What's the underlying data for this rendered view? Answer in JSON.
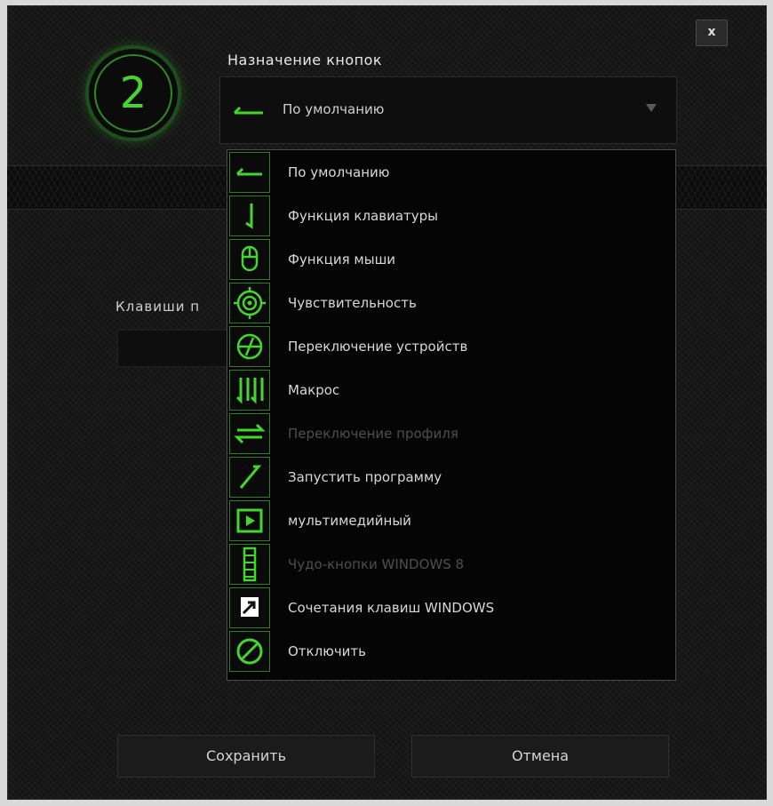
{
  "dialog": {
    "close_label": "x",
    "button_number": "2",
    "title": "Назначение кнопок",
    "selected": {
      "label": "По умолчанию",
      "icon": "default-arrow-icon"
    },
    "hidden_label": "Клавиши п",
    "menu": [
      {
        "label": "По умолчанию",
        "icon": "default-arrow-icon",
        "enabled": true
      },
      {
        "label": "Функция клавиатуры",
        "icon": "keyboard-function-icon",
        "enabled": true
      },
      {
        "label": "Функция мыши",
        "icon": "mouse-icon",
        "enabled": true
      },
      {
        "label": "Чувствительность",
        "icon": "sensitivity-target-icon",
        "enabled": true
      },
      {
        "label": "Переключение устройств",
        "icon": "device-switch-icon",
        "enabled": true
      },
      {
        "label": "Макрос",
        "icon": "macro-icon",
        "enabled": true
      },
      {
        "label": "Переключение профиля",
        "icon": "profile-switch-icon",
        "enabled": false
      },
      {
        "label": "Запустить программу",
        "icon": "launch-program-icon",
        "enabled": true
      },
      {
        "label": "мультимедийный",
        "icon": "multimedia-play-icon",
        "enabled": true
      },
      {
        "label": "Чудо-кнопки WINDOWS 8",
        "icon": "charms-icon",
        "enabled": false
      },
      {
        "label": "Сочетания клавиш WINDOWS",
        "icon": "windows-shortcut-icon",
        "enabled": true
      },
      {
        "label": "Отключить",
        "icon": "disable-icon",
        "enabled": true
      }
    ],
    "save_label": "Сохранить",
    "cancel_label": "Отмена"
  },
  "colors": {
    "accent": "#44d62c",
    "background": "#141414",
    "text": "#d8d8d8",
    "disabled_text": "#4e4e4e"
  }
}
